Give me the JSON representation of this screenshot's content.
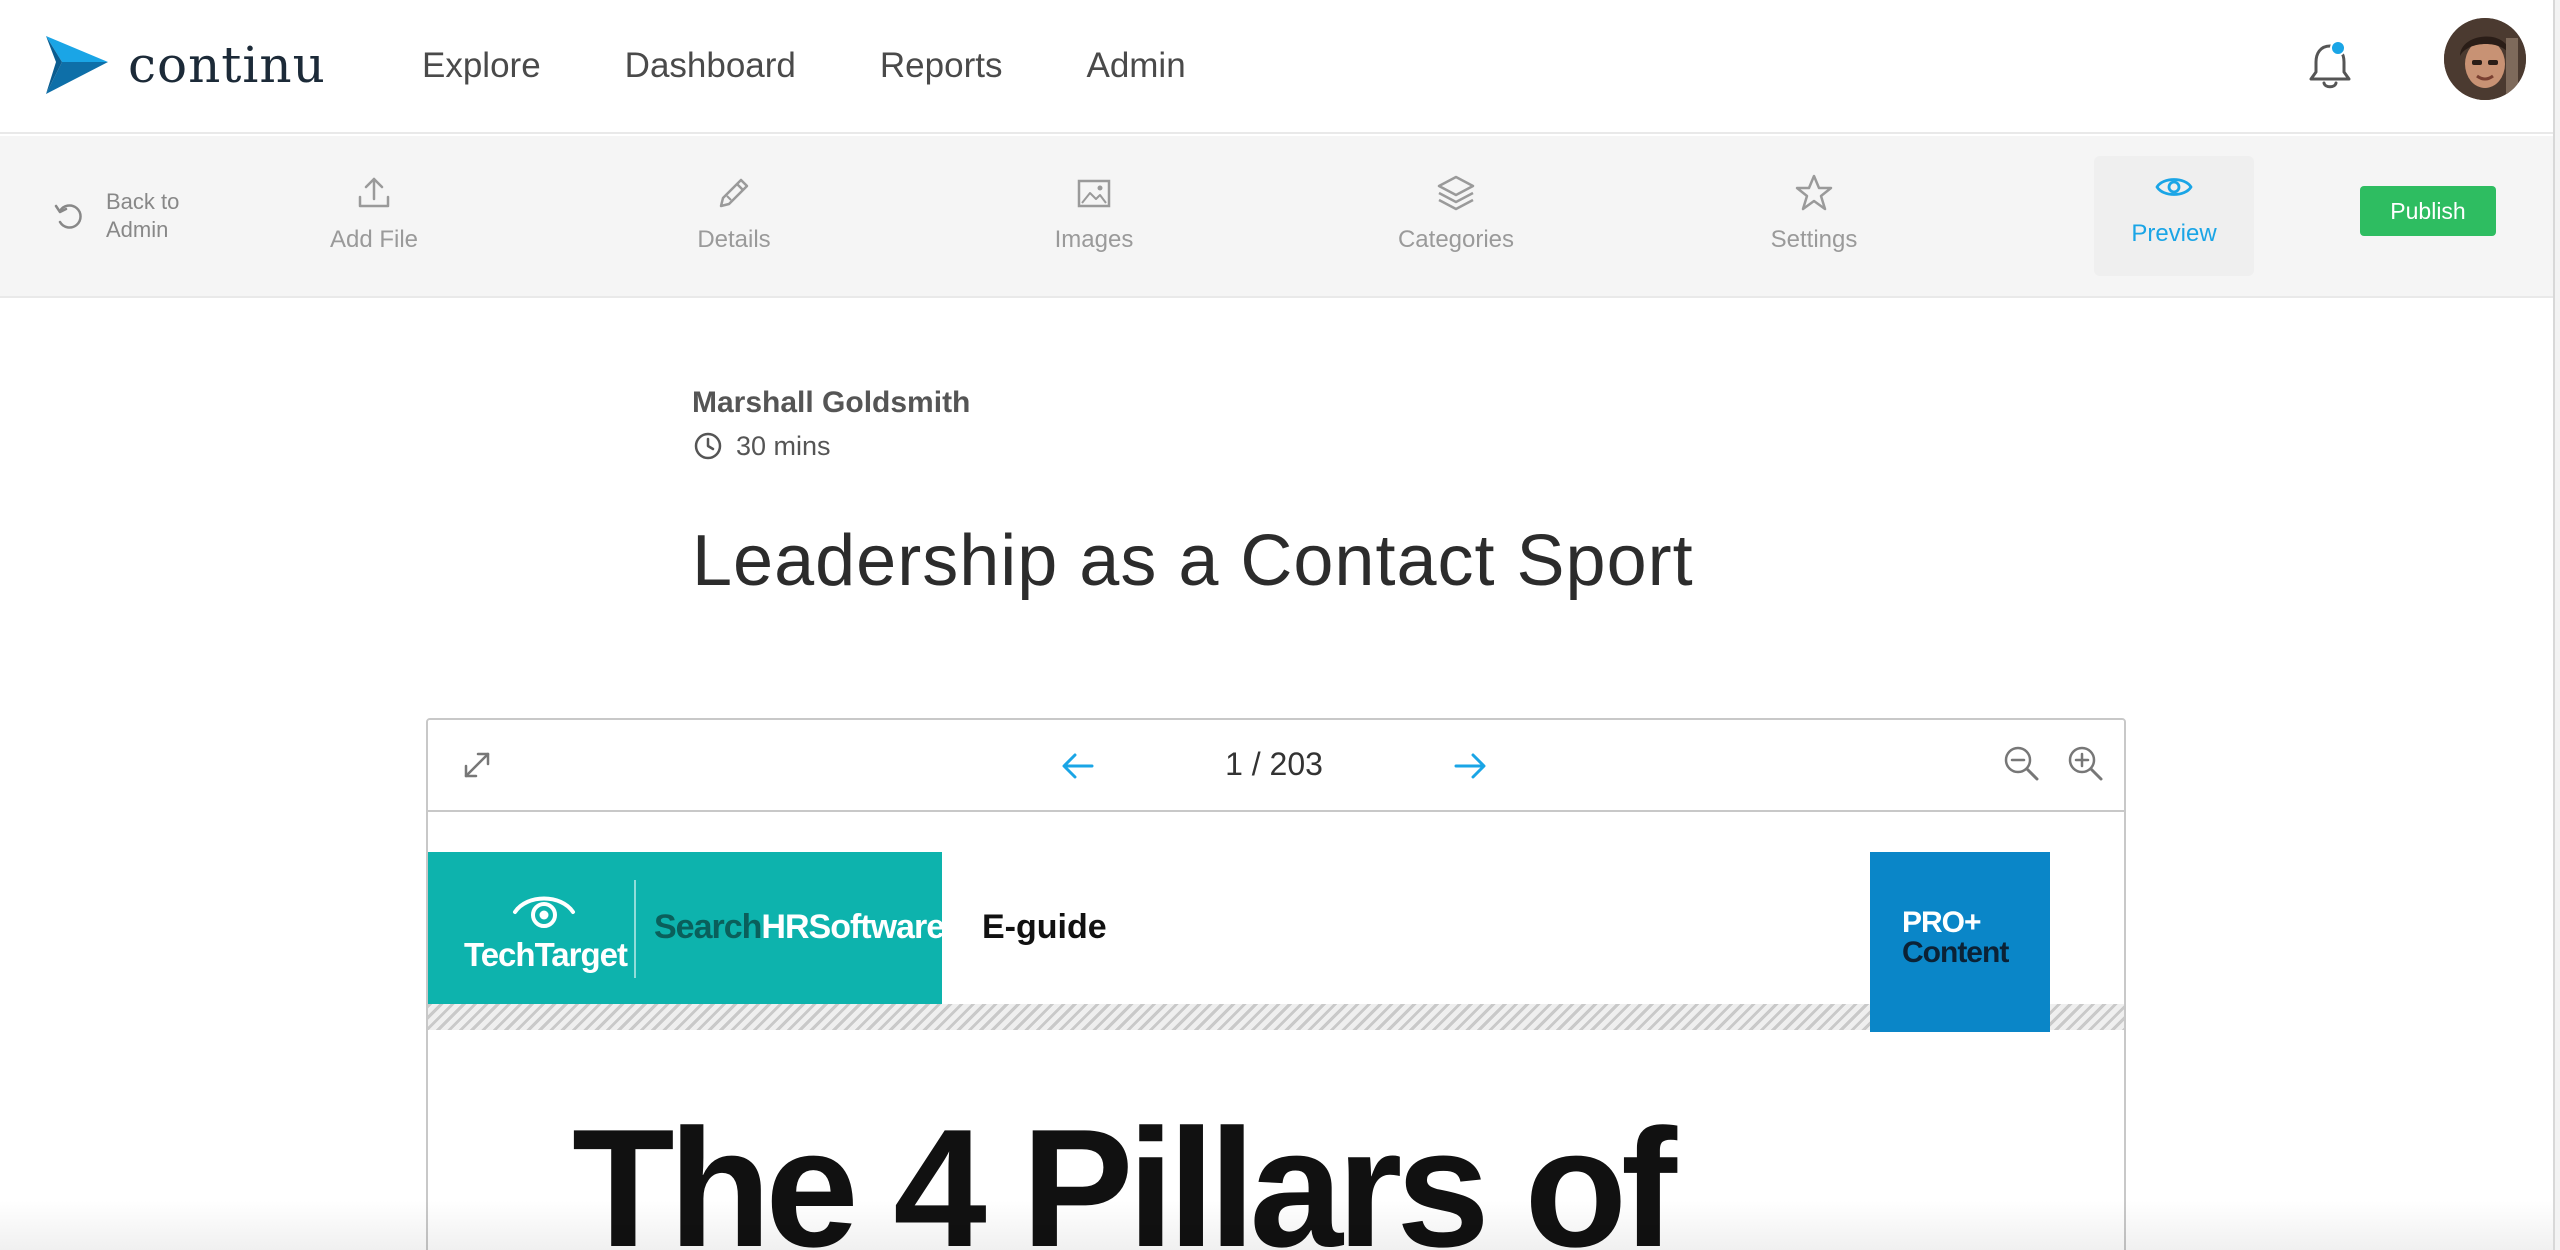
{
  "app": {
    "brand": "continu",
    "nav": [
      "Explore",
      "Dashboard",
      "Reports",
      "Admin"
    ],
    "colors": {
      "accent": "#1aa5e6",
      "publish": "#2ebd61",
      "brand_dark": "#1c2a38"
    }
  },
  "toolbar": {
    "back_label": "Back to Admin",
    "items": [
      {
        "label": "Add File",
        "icon": "upload-icon"
      },
      {
        "label": "Details",
        "icon": "pencil-icon"
      },
      {
        "label": "Images",
        "icon": "image-icon"
      },
      {
        "label": "Categories",
        "icon": "layers-icon"
      },
      {
        "label": "Settings",
        "icon": "star-icon"
      },
      {
        "label": "Preview",
        "icon": "eye-icon",
        "active": true
      }
    ],
    "publish_label": "Publish"
  },
  "content": {
    "author": "Marshall Goldsmith",
    "duration": "30 mins",
    "title": "Leadership as a Contact Sport"
  },
  "viewer": {
    "page_indicator": "1 / 203",
    "document": {
      "publisher": "TechTarget",
      "site_brand_part1": "Search",
      "site_brand_part2": "HRSoftware",
      "doc_type": "E-guide",
      "badge_line1": "PRO+",
      "badge_line2": "Content",
      "heading": "The 4 Pillars of"
    }
  }
}
